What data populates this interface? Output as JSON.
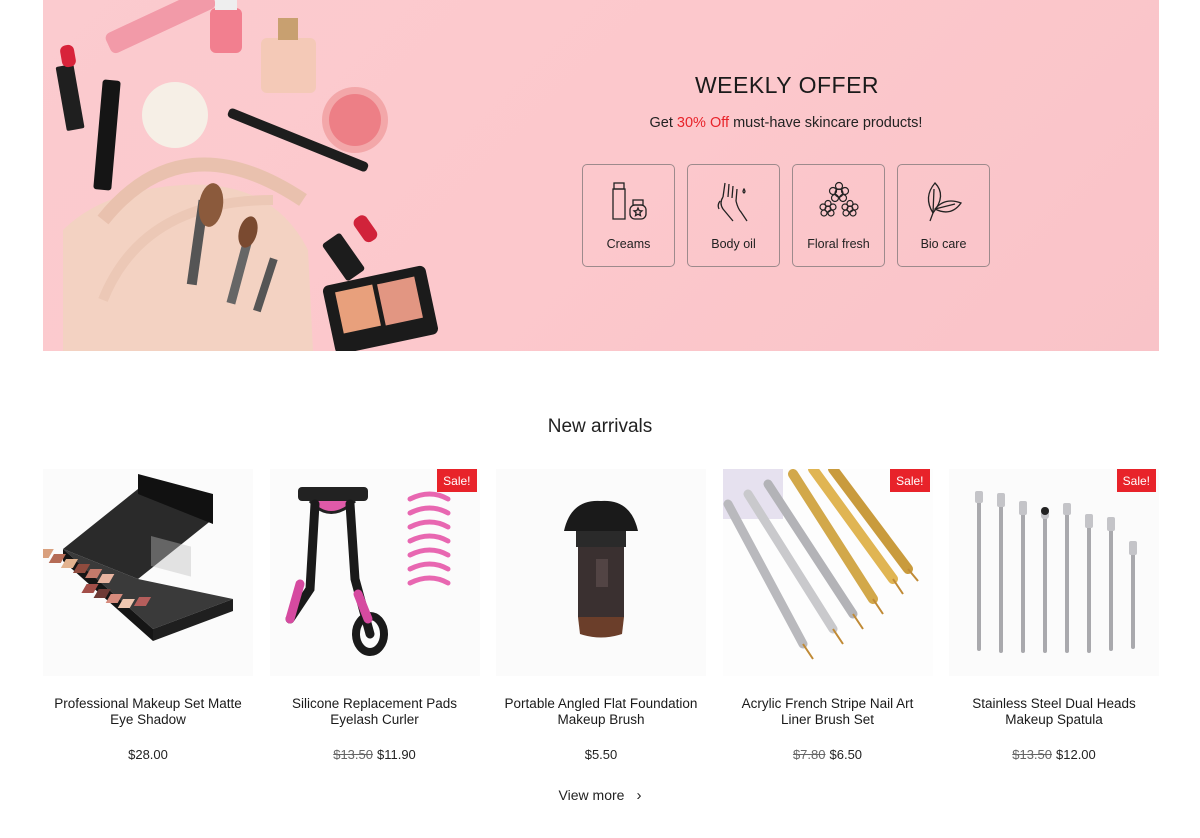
{
  "banner": {
    "title": "WEEKLY OFFER",
    "subtitle_prefix": "Get ",
    "subtitle_highlight": "30% Off",
    "subtitle_suffix": " must-have skincare products!",
    "accent_color": "#e8232a",
    "background_color": "#fcc8cc",
    "categories": [
      {
        "label": "Creams",
        "icon": "cream-bottle-icon"
      },
      {
        "label": "Body oil",
        "icon": "hand-drop-icon"
      },
      {
        "label": "Floral fresh",
        "icon": "flower-icon"
      },
      {
        "label": "Bio care",
        "icon": "leaf-icon"
      }
    ]
  },
  "new_arrivals": {
    "title": "New arrivals",
    "sale_label": "Sale!",
    "products": [
      {
        "name": "Professional Makeup Set Matte Eye Shadow",
        "price": "$28.00",
        "old_price": null,
        "sale": false
      },
      {
        "name": "Silicone Replacement Pads Eyelash Curler",
        "price": "$11.90",
        "old_price": "$13.50",
        "sale": true
      },
      {
        "name": "Portable Angled Flat Foundation Makeup Brush",
        "price": "$5.50",
        "old_price": null,
        "sale": false
      },
      {
        "name": "Acrylic French Stripe Nail Art Liner Brush Set",
        "price": "$6.50",
        "old_price": "$7.80",
        "sale": true
      },
      {
        "name": "Stainless Steel Dual Heads Makeup Spatula",
        "price": "$12.00",
        "old_price": "$13.50",
        "sale": true
      }
    ],
    "view_more": "View more",
    "view_more_icon": "chevron-right-icon"
  }
}
